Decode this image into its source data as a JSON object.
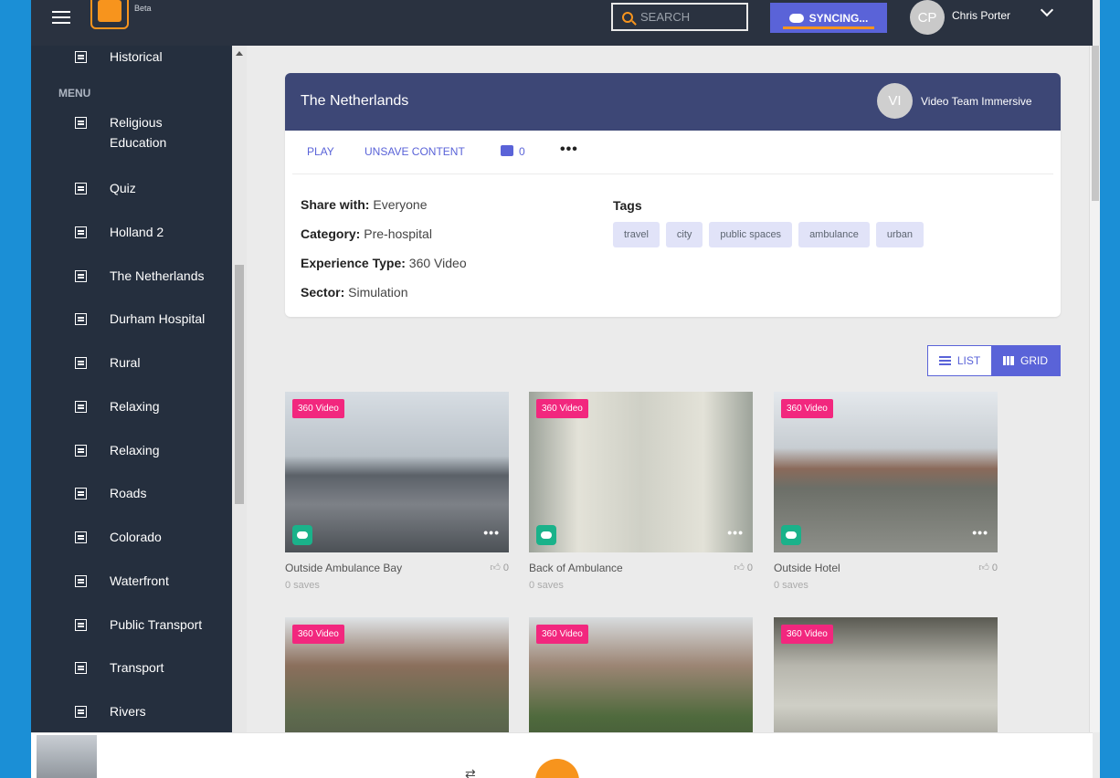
{
  "topbar": {
    "beta_label": "Beta",
    "search_placeholder": "SEARCH",
    "sync_label": "SYNCING...",
    "user_initials": "CP",
    "user_name": "Chris Porter"
  },
  "sidebar": {
    "menu_heading": "MENU",
    "items": [
      {
        "label": "Historical"
      },
      {
        "label": "Religious Education"
      },
      {
        "label": "Quiz"
      },
      {
        "label": "Holland 2"
      },
      {
        "label": "The Netherlands"
      },
      {
        "label": "Durham Hospital"
      },
      {
        "label": "Rural"
      },
      {
        "label": "Relaxing"
      },
      {
        "label": "Relaxing"
      },
      {
        "label": "Roads"
      },
      {
        "label": "Colorado"
      },
      {
        "label": "Waterfront"
      },
      {
        "label": "Public Transport"
      },
      {
        "label": "Transport"
      },
      {
        "label": "Rivers"
      }
    ]
  },
  "card": {
    "title": "The Netherlands",
    "owner_initials": "VI",
    "owner_name": "Video Team Immersive",
    "actions": {
      "play": "PLAY",
      "unsave": "UNSAVE CONTENT",
      "likes": "0"
    },
    "meta": [
      {
        "key": "Share with:",
        "value": "Everyone"
      },
      {
        "key": "Category:",
        "value": "Pre-hospital"
      },
      {
        "key": "Experience Type:",
        "value": "360 Video"
      },
      {
        "key": "Sector:",
        "value": "Simulation"
      }
    ],
    "tags_title": "Tags",
    "tags": [
      "travel",
      "city",
      "public spaces",
      "ambulance",
      "urban"
    ]
  },
  "view_toggle": {
    "list": "LIST",
    "grid": "GRID",
    "active": "grid"
  },
  "tiles": [
    {
      "badge": "360 Video",
      "title": "Outside Ambulance Bay",
      "likes": "0",
      "saves": "0 saves"
    },
    {
      "badge": "360 Video",
      "title": "Back of Ambulance",
      "likes": "0",
      "saves": "0 saves"
    },
    {
      "badge": "360 Video",
      "title": "Outside Hotel",
      "likes": "0",
      "saves": "0 saves"
    },
    {
      "badge": "360 Video"
    },
    {
      "badge": "360 Video"
    },
    {
      "badge": "360 Video"
    }
  ],
  "colors": {
    "accent": "#5a63d8",
    "brand_orange": "#f7941d",
    "sidebar_bg": "#252f3e",
    "card_header": "#3d4776",
    "badge_pink": "#f2277e",
    "cloud_green": "#1ab28a"
  }
}
